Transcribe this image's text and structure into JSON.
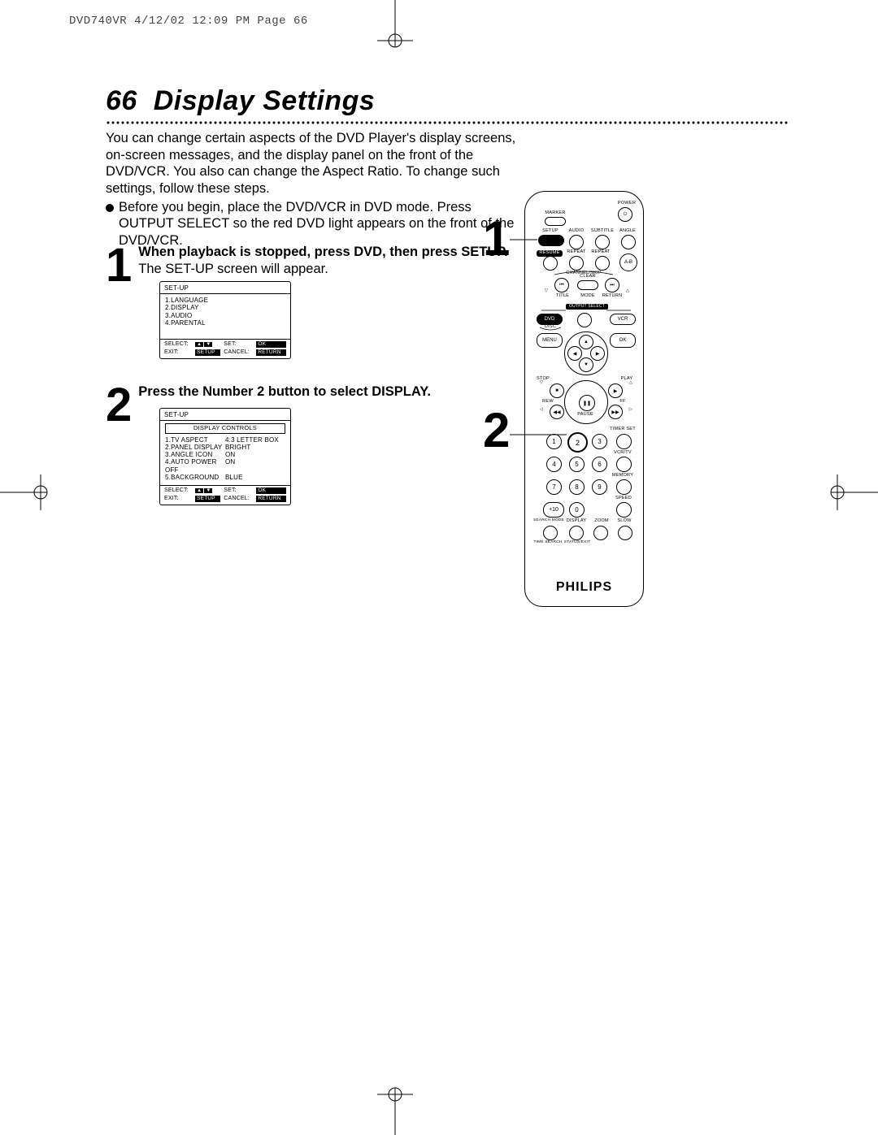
{
  "print_header": "DVD740VR  4/12/02  12:09 PM  Page 66",
  "page_number": "66",
  "page_title": "Display Settings",
  "intro": {
    "p1": "You can change certain aspects of the DVD Player's display screens, on-screen messages, and the display panel on the front of the DVD/VCR. You also can change the Aspect Ratio. To change such settings, follow these steps.",
    "bullet": "Before you begin, place the DVD/VCR in DVD mode. Press OUTPUT SELECT so the red DVD light appears on the front of the DVD/VCR."
  },
  "steps": {
    "s1": {
      "num": "1",
      "bold1": "When playback is stopped, press DVD, then press SETUP.",
      "rest": " The SET-UP screen will appear."
    },
    "s2": {
      "num": "2",
      "bold1": "Press the Number 2 button to select DISPLAY."
    }
  },
  "osd1": {
    "title": "SET-UP",
    "items": [
      "1.LANGUAGE",
      "2.DISPLAY",
      "3.AUDIO",
      "4.PARENTAL"
    ],
    "footer": {
      "select": "SELECT:",
      "set": "SET:",
      "ok": "OK",
      "exit": "EXIT:",
      "setup": "SETUP",
      "cancel": "CANCEL:",
      "return": "RETURN"
    }
  },
  "osd2": {
    "title": "SET-UP",
    "subtitle": "DISPLAY CONTROLS",
    "rows": [
      {
        "l": "1.TV ASPECT",
        "r": "4:3 LETTER BOX"
      },
      {
        "l": "2.PANEL DISPLAY",
        "r": "BRIGHT"
      },
      {
        "l": "3.ANGLE ICON",
        "r": "ON"
      },
      {
        "l": "4.AUTO POWER OFF",
        "r": "ON"
      },
      {
        "l": "5.BACKGROUND",
        "r": "BLUE"
      }
    ],
    "footer": {
      "select": "SELECT:",
      "set": "SET:",
      "ok": "OK",
      "exit": "EXIT:",
      "setup": "SETUP",
      "cancel": "CANCEL:",
      "return": "RETURN"
    }
  },
  "remote": {
    "callout1": "1",
    "callout2": "2",
    "brand": "PHILIPS",
    "labels": {
      "power": "POWER",
      "marker": "MARKER",
      "setup": "SETUP",
      "audio": "AUDIO",
      "subtitle": "SUBTITLE",
      "angle": "ANGLE",
      "resume": "RESUME",
      "repeat": "REPEAT",
      "repeat2": "REPEAT",
      "ab": "A-B",
      "channel_skip": "CHANNEL/SKIP",
      "clear": "CLEAR",
      "title": "TITLE",
      "mode": "MODE",
      "return": "RETURN",
      "output_select": "OUTPUT SELECT",
      "dvd": "DVD",
      "vcr": "VCR",
      "disc": "DISC",
      "menu": "MENU",
      "ok": "OK",
      "stop": "STOP",
      "play": "PLAY",
      "rew": "REW",
      "ff": "FF",
      "pause": "PAUSE",
      "timer_set": "TIMER SET",
      "vcr_tv": "VCR/TV",
      "memory": "MEMORY",
      "speed": "SPEED",
      "searchmode": "SEARCH MODE",
      "display": "DISPLAY",
      "zoom": "ZOOM",
      "slow": "SLOW",
      "time_search": "TIME SEARCH",
      "status_exit": "STATUS/EXIT"
    },
    "numpad": [
      "1",
      "2",
      "3",
      "4",
      "5",
      "6",
      "7",
      "8",
      "9",
      "+10",
      "0"
    ]
  }
}
